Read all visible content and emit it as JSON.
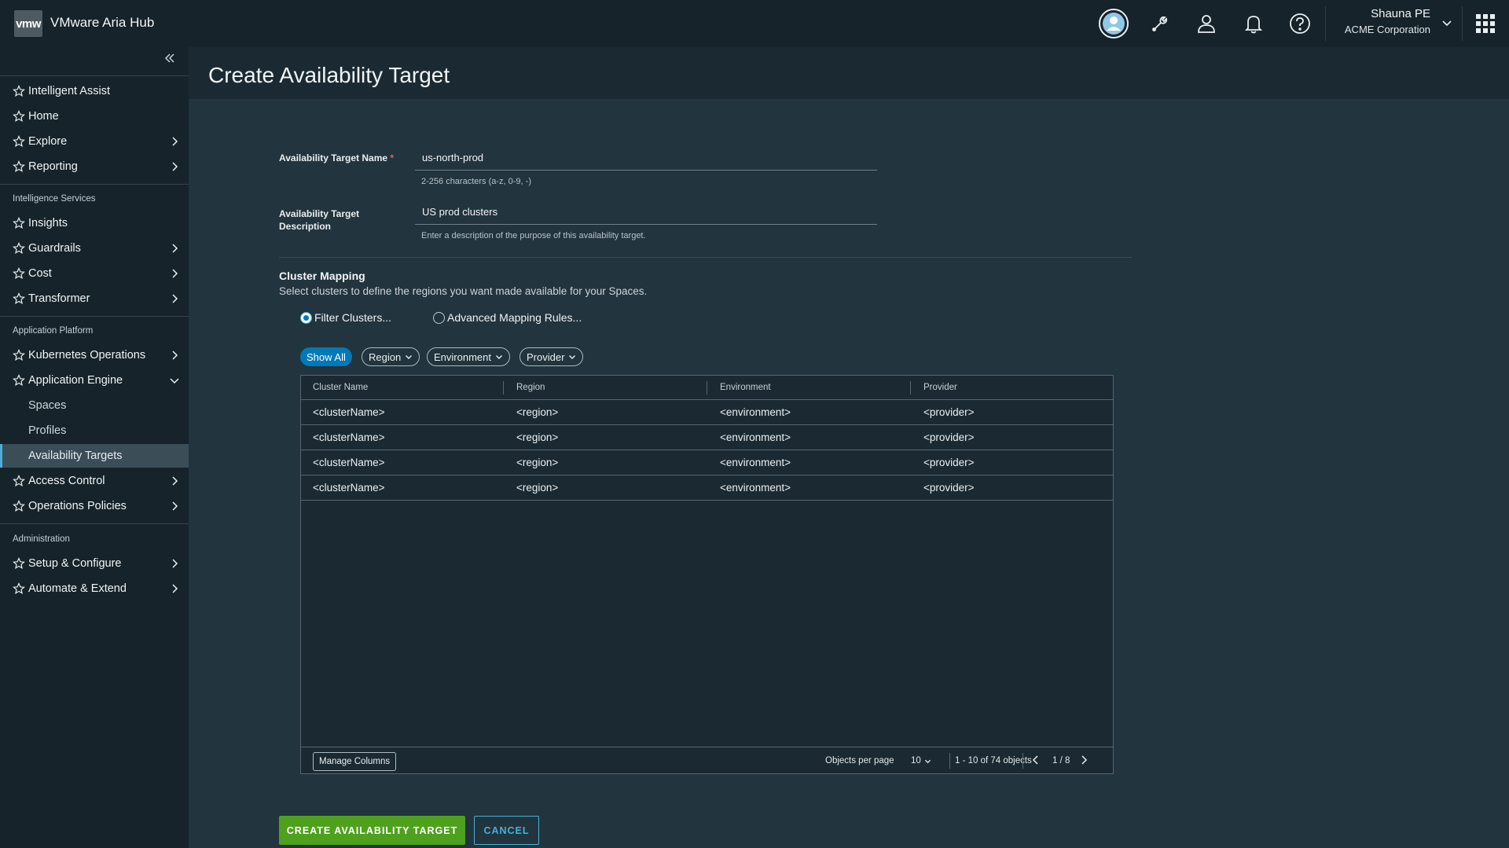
{
  "header": {
    "logo_text": "vmw",
    "app_title": "VMware Aria Hub",
    "user_name": "Shauna PE",
    "user_org": "ACME Corporation",
    "icons": [
      "avatar-icon",
      "wrench-icon",
      "user-icon",
      "bell-icon",
      "help-icon",
      "apps-grid-icon"
    ]
  },
  "sidebar": {
    "collapse_icon": "double-chevron-left-icon",
    "top_items": [
      {
        "label": "Intelligent Assist"
      },
      {
        "label": "Home"
      },
      {
        "label": "Explore"
      },
      {
        "label": "Reporting"
      }
    ],
    "groups": [
      {
        "title": "Intelligence Services",
        "items": [
          {
            "label": "Insights"
          },
          {
            "label": "Guardrails"
          },
          {
            "label": "Cost"
          },
          {
            "label": "Transformer"
          }
        ]
      },
      {
        "title": "Application Platform",
        "items": [
          {
            "label": "Kubernetes Operations"
          },
          {
            "label": "Application Engine"
          },
          {
            "label": "Access Control"
          },
          {
            "label": "Operations Policies"
          }
        ],
        "sub_items": [
          {
            "label": "Spaces"
          },
          {
            "label": "Profiles"
          },
          {
            "label": "Availability Targets"
          }
        ]
      },
      {
        "title": "Administration",
        "items": [
          {
            "label": "Setup & Configure"
          },
          {
            "label": "Automate & Extend"
          }
        ]
      }
    ]
  },
  "page": {
    "title": "Create Availability Target"
  },
  "form": {
    "name_label": "Availability Target Name",
    "required_mark": "*",
    "name_value": "us-north-prod",
    "name_help": "2-256 characters (a-z, 0-9, -)",
    "desc_label_line1": "Availability Target",
    "desc_label_line2": "Description",
    "desc_value": "US prod clusters",
    "desc_help": "Enter a description of the purpose of this availability target."
  },
  "cluster_mapping": {
    "title": "Cluster Mapping",
    "description": "Select clusters to define the regions you want made available for your Spaces.",
    "radio_filter": "Filter Clusters...",
    "radio_advanced": "Advanced Mapping Rules...",
    "chips": {
      "show_all": "Show All",
      "region": "Region",
      "environment": "Environment",
      "provider": "Provider"
    }
  },
  "grid": {
    "columns": [
      "Cluster Name",
      "Region",
      "Environment",
      "Provider"
    ],
    "rows": [
      [
        "<clusterName>",
        "<region>",
        "<environment>",
        "<provider>"
      ],
      [
        "<clusterName>",
        "<region>",
        "<environment>",
        "<provider>"
      ],
      [
        "<clusterName>",
        "<region>",
        "<environment>",
        "<provider>"
      ],
      [
        "<clusterName>",
        "<region>",
        "<environment>",
        "<provider>"
      ]
    ],
    "footer": {
      "manage_columns": "Manage Columns",
      "objects_per_page_label": "Objects  per page",
      "page_size": "10",
      "range": "1 - 10 of 74 objects",
      "page_indicator": "1 / 8"
    }
  },
  "actions": {
    "create": "CREATE AVAILABILITY TARGET",
    "cancel": "CANCEL"
  },
  "colors": {
    "accent_blue": "#0079b8",
    "primary_green": "#4ea11d",
    "link_blue": "#49afd9"
  }
}
